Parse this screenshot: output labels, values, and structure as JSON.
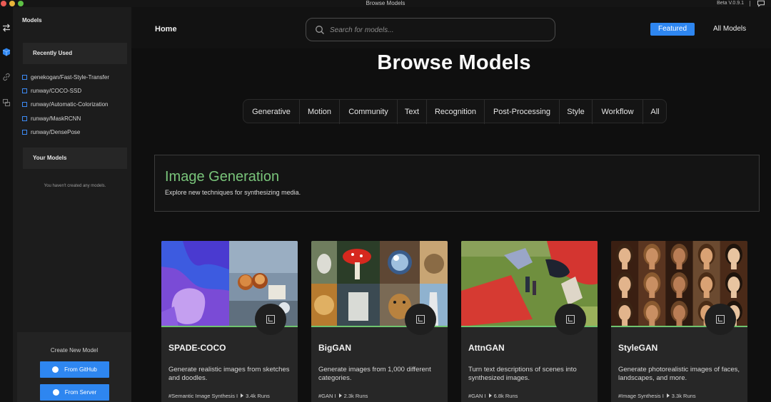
{
  "window": {
    "title": "Browse Models",
    "version": "Beta V.0.9.1"
  },
  "sidebar": {
    "section_title": "Models",
    "recently_used_label": "Recently Used",
    "recent_items": [
      {
        "label": "genekogan/Fast-Style-Transfer"
      },
      {
        "label": "runway/COCO-SSD"
      },
      {
        "label": "runway/Automatic-Colorization"
      },
      {
        "label": "runway/MaskRCNN"
      },
      {
        "label": "runway/DensePose"
      }
    ],
    "your_models_label": "Your Models",
    "empty_note": "You haven't created any models.",
    "create_title": "Create New Model",
    "github_button": "From GitHub",
    "server_button": "From Server"
  },
  "header": {
    "home_label": "Home",
    "search_placeholder": "Search for models...",
    "featured_label": "Featured",
    "all_models_label": "All Models"
  },
  "main": {
    "title": "Browse Models",
    "categories": [
      {
        "label": "Generative"
      },
      {
        "label": "Motion"
      },
      {
        "label": "Community"
      },
      {
        "label": "Text"
      },
      {
        "label": "Recognition"
      },
      {
        "label": "Post-Processing"
      },
      {
        "label": "Style"
      },
      {
        "label": "Workflow"
      },
      {
        "label": "All"
      }
    ],
    "section": {
      "title": "Image Generation",
      "subtitle": "Explore new techniques for synthesizing media."
    },
    "cards": [
      {
        "title": "SPADE-COCO",
        "desc": "Generate realistic images from sketches and doodles.",
        "tag": "#Semantic Image Synthesis I",
        "runs": "3.4k Runs"
      },
      {
        "title": "BigGAN",
        "desc": "Generate images from 1,000 different categories.",
        "tag": "#GAN I",
        "runs": "2.3k Runs"
      },
      {
        "title": "AttnGAN",
        "desc": "Turn text descriptions of scenes into synthesized images.",
        "tag": "#GAN I",
        "runs": "6.8k Runs"
      },
      {
        "title": "StyleGAN",
        "desc": "Generate photorealistic images of faces, landscapes, and more.",
        "tag": "#Image Synthesis I",
        "runs": "3.3k Runs"
      }
    ]
  },
  "colors": {
    "accent": "#2e86f0",
    "section_green": "#79c47a",
    "card_line": "#6fc46f"
  }
}
